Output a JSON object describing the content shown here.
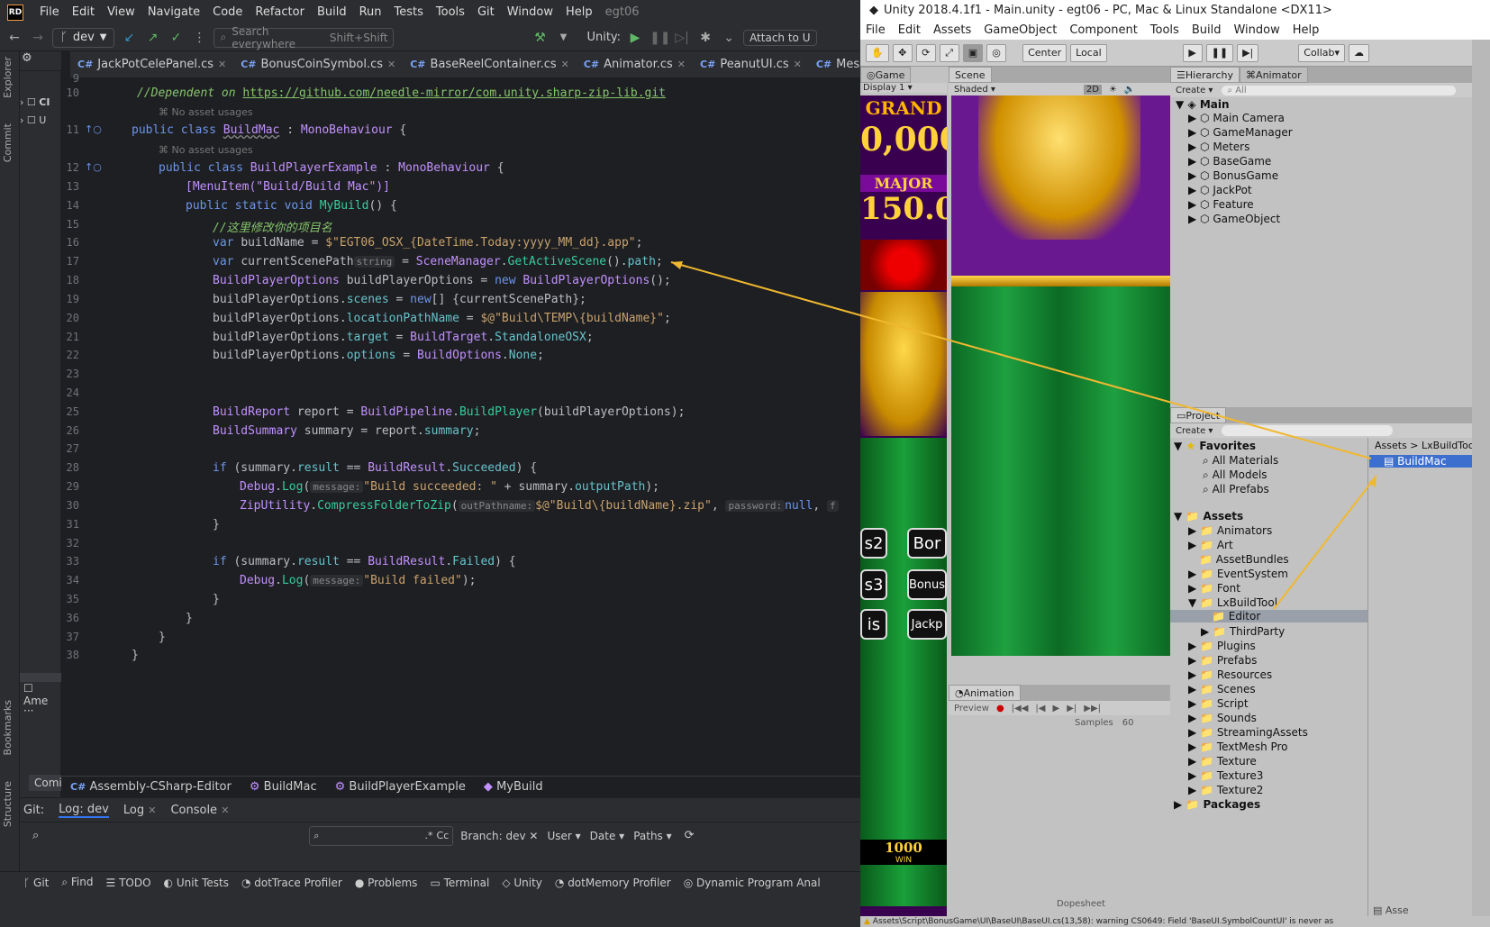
{
  "rider": {
    "logo": "RD",
    "menu": [
      "File",
      "Edit",
      "View",
      "Navigate",
      "Code",
      "Refactor",
      "Build",
      "Run",
      "Tests",
      "Tools",
      "Git",
      "Window",
      "Help"
    ],
    "project_name": "egt06",
    "branch": "dev",
    "search_placeholder": "Search everywhere",
    "search_shortcut": "Shift+Shift",
    "unity_label": "Unity:",
    "attach_label": "Attach to U",
    "tabs": [
      "JackPotCelePanel.cs",
      "BonusCoinSymbol.cs",
      "BaseReelContainer.cs",
      "Animator.cs",
      "PeanutUI.cs",
      "MessageLoop.cs"
    ],
    "left_strip": [
      "Explorer",
      "Commit",
      "Bookmarks",
      "Structure"
    ],
    "line_numbers": [
      "9",
      "10",
      "11",
      "12",
      "13",
      "14",
      "15",
      "16",
      "17",
      "18",
      "19",
      "20",
      "21",
      "22",
      "23",
      "24",
      "25",
      "26",
      "27",
      "28",
      "29",
      "30",
      "31",
      "32",
      "33",
      "34",
      "35",
      "36",
      "37",
      "38"
    ],
    "code": {
      "l10_comment": "//Dependent on ",
      "l10_link": "https://github.com/needle-mirror/com.unity.sharp-zip-lib.git",
      "no_usages": "No asset usages",
      "l11": "BuildMac",
      "l12": "BuildPlayerExample",
      "l13": "[MenuItem(\"Build/Build Mac\")]",
      "l14_method": "MyBuild",
      "l15": "//这里修改你的项目名",
      "l16_str": "$\"EGT06_OSX_{DateTime.Today:yyyy_MM_dd}.app\"",
      "l17_hint": "string",
      "l20_str": "$@\"Build\\TEMP\\{buildName}\"",
      "l29_str": "\"Build succeeded: \"",
      "l30_str": "$@\"Build\\{buildName}.zip\"",
      "l34_str": "\"Build failed\""
    },
    "breadcrumb": [
      "Assembly-CSharp-Editor",
      "BuildMac",
      "BuildPlayerExample",
      "MyBuild"
    ],
    "git_tabs": [
      "Git:",
      "Log: dev",
      "Log",
      "Console"
    ],
    "git_filters": {
      "branch": "Branch: dev",
      "user": "User",
      "date": "Date",
      "paths": "Paths"
    },
    "bottom_tools": [
      "Git",
      "Find",
      "TODO",
      "Unit Tests",
      "dotTrace Profiler",
      "Problems",
      "Terminal",
      "Unity",
      "dotMemory Profiler",
      "Dynamic Program Anal"
    ],
    "left_partial": [
      "Comi",
      "Ame"
    ]
  },
  "unity": {
    "title": "Unity 2018.4.1f1 - Main.unity - egt06 - PC, Mac & Linux Standalone <DX11>",
    "menu": [
      "File",
      "Edit",
      "Assets",
      "GameObject",
      "Component",
      "Tools",
      "Build",
      "Window",
      "Help"
    ],
    "toolbar": {
      "center": "Center",
      "local": "Local",
      "collab": "Collab"
    },
    "game_tab": "Game",
    "display": "Display 1",
    "scene_tab": "Scene",
    "shaded": "Shaded",
    "mode_2d": "2D",
    "hierarchy_tab": "Hierarchy",
    "animator_tab": "Animator",
    "create": "Create",
    "search_all": "All",
    "scene_root": "Main",
    "hierarchy": [
      "Main Camera",
      "GameManager",
      "Meters",
      "BaseGame",
      "BonusGame",
      "JackPot",
      "Feature",
      "GameObject"
    ],
    "project_tab": "Project",
    "favorites": "Favorites",
    "fav_items": [
      "All Materials",
      "All Models",
      "All Prefabs"
    ],
    "assets": "Assets",
    "asset_folders": [
      "Animators",
      "Art",
      "AssetBundles",
      "EventSystem",
      "Font",
      "LxBuildTool",
      "Editor",
      "ThirdParty",
      "Plugins",
      "Prefabs",
      "Resources",
      "Scenes",
      "Script",
      "Sounds",
      "StreamingAssets",
      "TextMesh Pro",
      "Texture",
      "Texture3",
      "Texture2"
    ],
    "packages": "Packages",
    "path": [
      "Assets",
      "LxBuildToo"
    ],
    "selected_asset": "BuildMac",
    "animation_tab": "Animation",
    "preview": "Preview",
    "samples": "Samples",
    "samples_value": "60",
    "dopesheet": "Dopesheet",
    "game_labels": {
      "grand": "GRAND",
      "grand_val": "0,000",
      "major": "MAJOR",
      "major_val": "150.0",
      "win_val": "1000",
      "win": "WIN"
    },
    "buttons": [
      "s2",
      "Bor",
      "s3",
      "Bonus",
      "is",
      "Jackp"
    ],
    "status_warning": "Assets\\Script\\BonusGame\\UI\\BaseUI\\BaseUI.cs(13,58): warning CS0649: Field 'BaseUI.SymbolCountUI' is never as",
    "asse": "Asse"
  }
}
